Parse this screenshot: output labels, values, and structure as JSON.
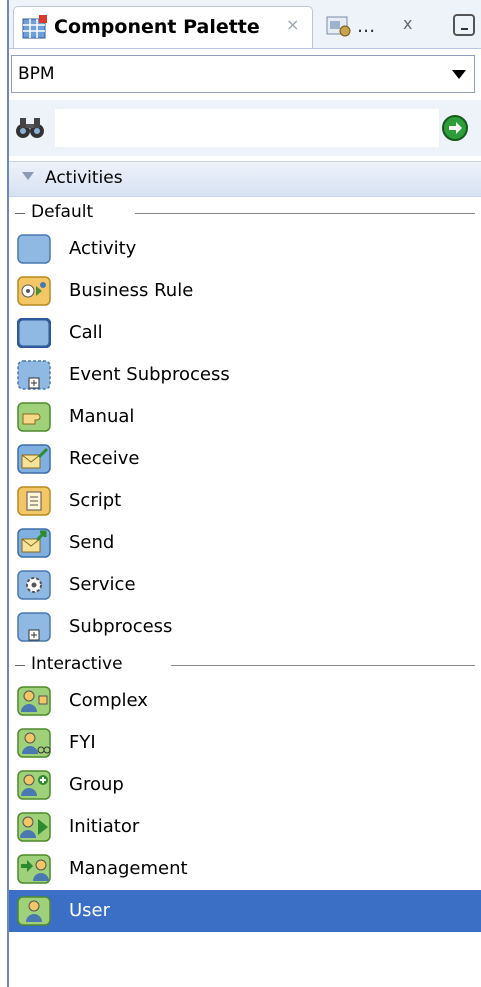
{
  "tabs": {
    "active_label": "Component Palette",
    "active_close": "×",
    "second_label": "...",
    "second_close": "x"
  },
  "dropdown": {
    "value": "BPM"
  },
  "search": {
    "value": ""
  },
  "activities": {
    "label": "Activities"
  },
  "sections": {
    "default": {
      "label": "Default"
    },
    "interactive": {
      "label": "Interactive"
    }
  },
  "default_items": [
    {
      "label": "Activity",
      "icon": "activity-icon"
    },
    {
      "label": "Business Rule",
      "icon": "business-rule-icon"
    },
    {
      "label": "Call",
      "icon": "call-icon"
    },
    {
      "label": "Event Subprocess",
      "icon": "event-subprocess-icon"
    },
    {
      "label": "Manual",
      "icon": "manual-icon"
    },
    {
      "label": "Receive",
      "icon": "receive-icon"
    },
    {
      "label": "Script",
      "icon": "script-icon"
    },
    {
      "label": "Send",
      "icon": "send-icon"
    },
    {
      "label": "Service",
      "icon": "service-icon"
    },
    {
      "label": "Subprocess",
      "icon": "subprocess-icon"
    }
  ],
  "interactive_items": [
    {
      "label": "Complex",
      "icon": "complex-icon"
    },
    {
      "label": "FYI",
      "icon": "fyi-icon"
    },
    {
      "label": "Group",
      "icon": "group-icon"
    },
    {
      "label": "Initiator",
      "icon": "initiator-icon"
    },
    {
      "label": "Management",
      "icon": "management-icon"
    },
    {
      "label": "User",
      "icon": "user-icon"
    }
  ],
  "selected_item": "User",
  "colors": {
    "selection": "#3b6fc6",
    "header_bg": "#eef3fa"
  }
}
